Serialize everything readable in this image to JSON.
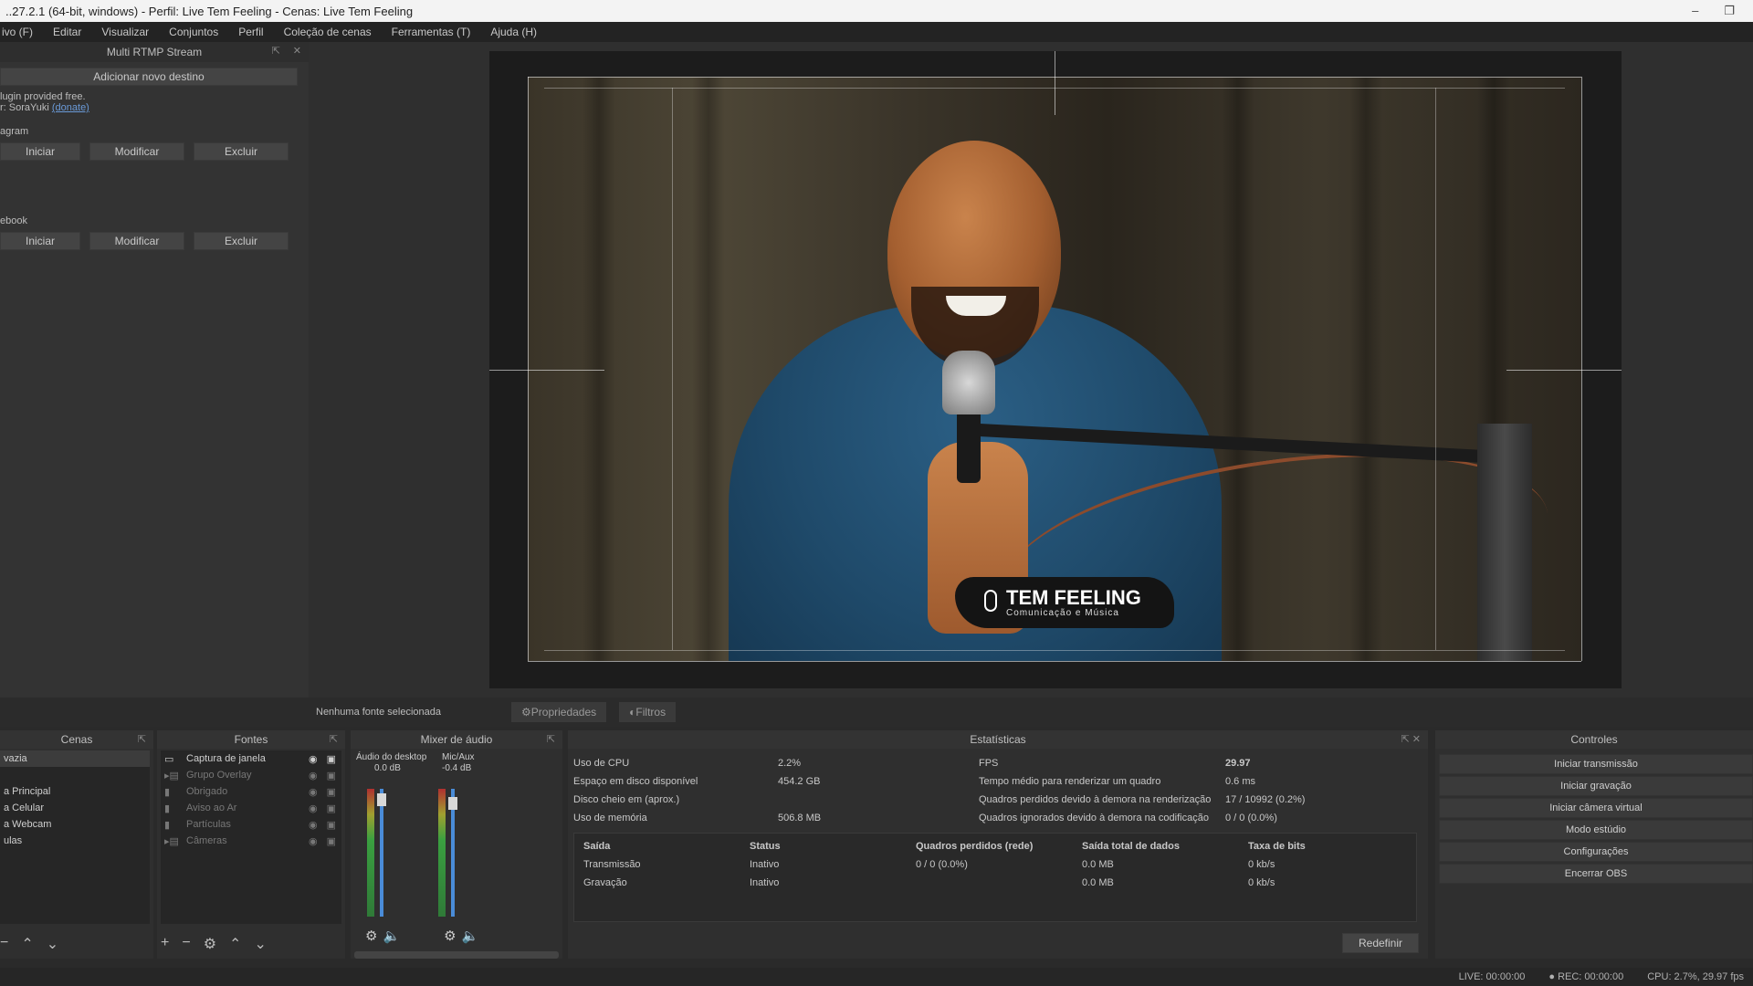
{
  "window": {
    "title": "..27.2.1 (64-bit, windows) - Perfil: Live Tem Feeling - Cenas: Live Tem Feeling",
    "minimize": "–",
    "maximize": "❐"
  },
  "menu": [
    "ivo (F)",
    "Editar",
    "Visualizar",
    "Conjuntos",
    "Perfil",
    "Coleção de cenas",
    "Ferramentas (T)",
    "Ajuda (H)"
  ],
  "left_dock": {
    "title": "Multi RTMP Stream",
    "add_button": "Adicionar novo destino",
    "info_line1": "lugin provided free.",
    "info_line2": "r: SoraYuki",
    "info_link": "(donate)",
    "targets": [
      {
        "name": "agram",
        "start": "Iniciar",
        "edit": "Modificar",
        "delete": "Excluir"
      },
      {
        "name": "ebook",
        "start": "Iniciar",
        "edit": "Modificar",
        "delete": "Excluir"
      }
    ]
  },
  "preview": {
    "logo_main": "TEM FEELING",
    "logo_sub": "Comunicação e Música"
  },
  "source_bar": {
    "label": "Nenhuma fonte selecionada",
    "properties": "Propriedades",
    "filters": "Filtros"
  },
  "scenes": {
    "title": "Cenas",
    "items": [
      "vazia",
      "",
      "a Principal",
      "a Celular",
      "a Webcam",
      "ulas"
    ]
  },
  "sources": {
    "title": "Fontes",
    "items": [
      {
        "name": "Captura de janela",
        "dim": false
      },
      {
        "name": "Grupo Overlay",
        "dim": true
      },
      {
        "name": "Obrigado",
        "dim": true
      },
      {
        "name": "Aviso ao Ar",
        "dim": true
      },
      {
        "name": "Partículas",
        "dim": true
      },
      {
        "name": "Câmeras",
        "dim": true
      }
    ]
  },
  "mixer": {
    "title": "Mixer de áudio",
    "channels": [
      {
        "name": "Áudio do desktop",
        "db": "0.0 dB",
        "level": 0.95
      },
      {
        "name": "Mic/Aux",
        "db": "-0.4 dB",
        "level": 0.92
      }
    ]
  },
  "stats": {
    "title": "Estatísticas",
    "left": [
      {
        "k": "Uso de CPU",
        "v": "2.2%"
      },
      {
        "k": "Espaço em disco disponível",
        "v": "454.2 GB"
      },
      {
        "k": "Disco cheio em (aprox.)",
        "v": ""
      },
      {
        "k": "Uso de memória",
        "v": "506.8 MB"
      }
    ],
    "right": [
      {
        "k": "FPS",
        "v": "29.97"
      },
      {
        "k": "Tempo médio para renderizar um quadro",
        "v": "0.6 ms"
      },
      {
        "k": "Quadros perdidos devido à demora na renderização",
        "v": "17 / 10992 (0.2%)"
      },
      {
        "k": "Quadros ignorados devido à demora na codificação",
        "v": "0 / 0 (0.0%)"
      }
    ],
    "table_headers": [
      "Saída",
      "Status",
      "Quadros perdidos (rede)",
      "Saída total de dados",
      "Taxa de bits"
    ],
    "rows": [
      [
        "Transmissão",
        "Inativo",
        "0 / 0 (0.0%)",
        "0.0 MB",
        "0 kb/s"
      ],
      [
        "Gravação",
        "Inativo",
        "",
        "0.0 MB",
        "0 kb/s"
      ]
    ],
    "reset": "Redefinir"
  },
  "controls": {
    "title": "Controles",
    "buttons": [
      "Iniciar transmissão",
      "Iniciar gravação",
      "Iniciar câmera virtual",
      "Modo estúdio",
      "Configurações",
      "Encerrar OBS"
    ]
  },
  "status": {
    "live": "LIVE: 00:00:00",
    "rec": "REC: 00:00:00",
    "cpu": "CPU: 2.7%, 29.97 fps"
  }
}
